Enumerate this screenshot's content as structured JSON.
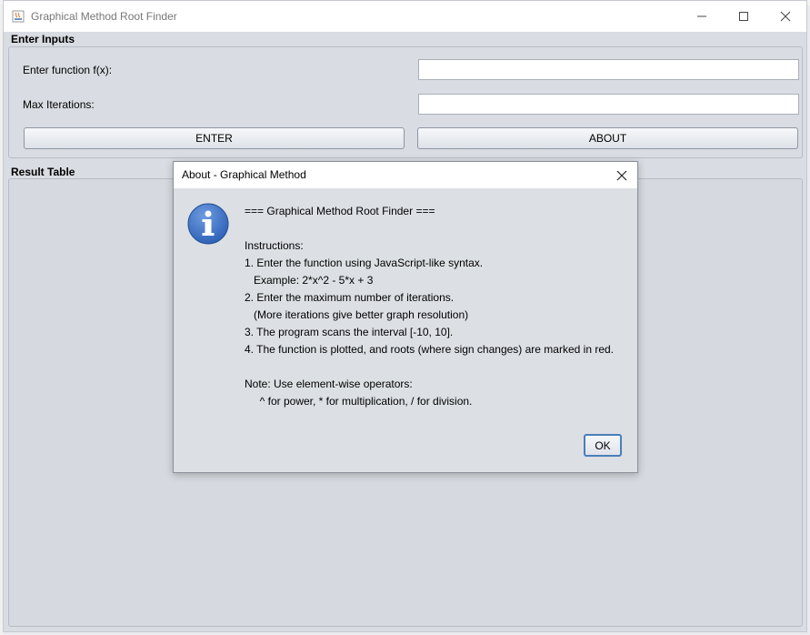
{
  "window": {
    "title": "Graphical Method Root Finder",
    "minimize_icon": "minimize-icon",
    "maximize_icon": "maximize-icon",
    "close_icon": "close-icon"
  },
  "inputs_section": {
    "label": "Enter Inputs",
    "function_label": "Enter function f(x):",
    "function_value": "",
    "iterations_label": "Max Iterations:",
    "iterations_value": "",
    "enter_button": "ENTER",
    "about_button": "ABOUT"
  },
  "result_section": {
    "label": "Result Table"
  },
  "dialog": {
    "title": "About - Graphical Method",
    "icon": "info-icon",
    "lines": [
      "=== Graphical Method Root Finder ===",
      "",
      "Instructions:",
      "1. Enter the function using JavaScript-like syntax.",
      "   Example: 2*x^2 - 5*x + 3",
      "2. Enter the maximum number of iterations.",
      "   (More iterations give better graph resolution)",
      "3. The program scans the interval [-10, 10].",
      "4. The function is plotted, and roots (where sign changes) are marked in red.",
      "",
      "Note: Use element-wise operators:",
      "     ^ for power, * for multiplication, / for division."
    ],
    "ok_button": "OK"
  },
  "colors": {
    "accent": "#4a7fb8",
    "info_icon": "#2f63b8",
    "window_bg": "#d9dce2"
  }
}
